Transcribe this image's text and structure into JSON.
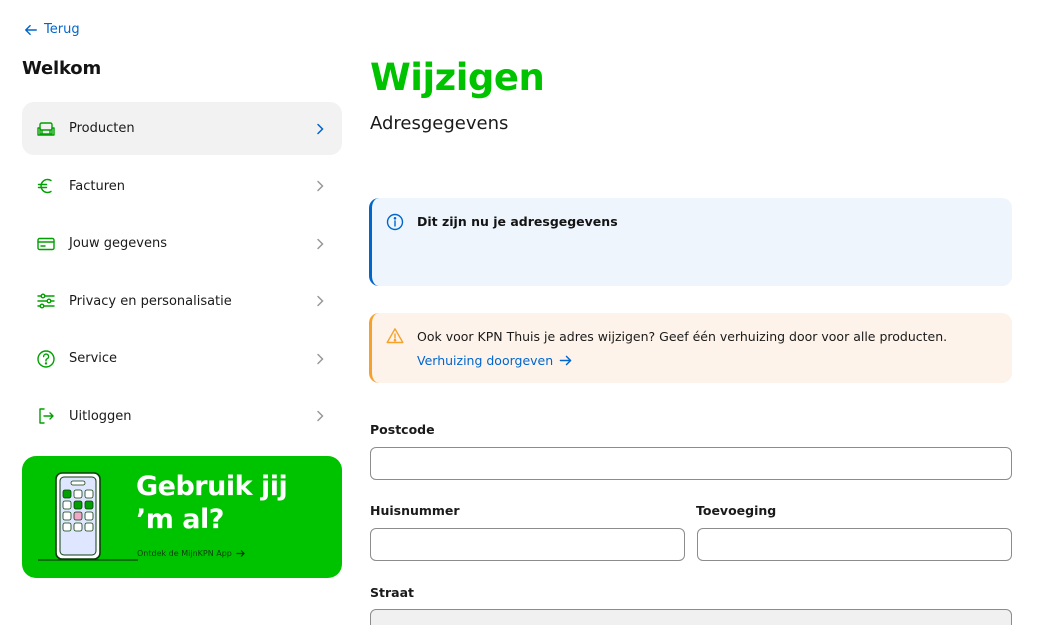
{
  "nav": {
    "back_label": "Terug"
  },
  "sidebar": {
    "title": "Welkom",
    "items": [
      {
        "label": "Producten",
        "icon": "sofa-icon"
      },
      {
        "label": "Facturen",
        "icon": "euro-icon"
      },
      {
        "label": "Jouw gegevens",
        "icon": "id-card-icon"
      },
      {
        "label": "Privacy en personalisatie",
        "icon": "sliders-icon"
      },
      {
        "label": "Service",
        "icon": "question-icon"
      },
      {
        "label": "Uitloggen",
        "icon": "logout-icon"
      }
    ]
  },
  "promo": {
    "title_line1": "Gebruik jij",
    "title_line2": "’m al?",
    "link": "Ontdek de MijnKPN App"
  },
  "main": {
    "title": "Wijzigen",
    "subtitle": "Adresgegevens"
  },
  "info_alert": {
    "text": "Dit zijn nu je adresgegevens"
  },
  "warning_alert": {
    "text": "Ook voor KPN Thuis je adres wijzigen? Geef één verhuizing door voor alle producten.",
    "link": "Verhuizing doorgeven"
  },
  "form": {
    "postcode": {
      "label": "Postcode",
      "value": ""
    },
    "huisnummer": {
      "label": "Huisnummer",
      "value": ""
    },
    "toevoeging": {
      "label": "Toevoeging",
      "value": ""
    },
    "straat": {
      "label": "Straat",
      "value": ""
    }
  },
  "colors": {
    "brand_green": "#00c300",
    "link_blue": "#0066cc",
    "warning_orange": "#f5a12a"
  }
}
